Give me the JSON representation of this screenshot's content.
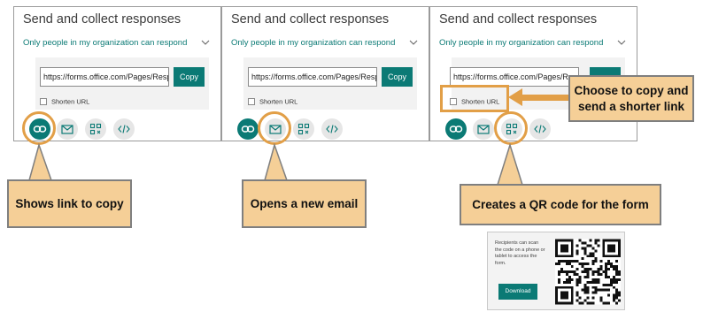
{
  "panels": [
    {
      "title": "Send and collect responses",
      "dropdown": "Only people in my organization can respond",
      "url": "https://forms.office.com/Pages/ResponsePage.aspx",
      "copy_label": "Copy",
      "shorten_label": "Shorten URL"
    },
    {
      "title": "Send and collect responses",
      "dropdown": "Only people in my organization can respond",
      "url": "https://forms.office.com/Pages/ResponsePage.aspx",
      "copy_label": "Copy",
      "shorten_label": "Shorten URL"
    },
    {
      "title": "Send and collect responses",
      "dropdown": "Only people in my organization can respond",
      "url": "https://forms.office.com/Pages/ResponsePage.aspx",
      "copy_label": "",
      "shorten_label": "Shorten URL"
    }
  ],
  "icons": [
    "link-icon",
    "mail-icon",
    "qr-code-icon",
    "embed-code-icon"
  ],
  "callouts": {
    "link": "Shows link to copy",
    "email": "Opens a new email",
    "qr": "Creates a QR code for the form",
    "shorten_line1": "Choose to copy and",
    "shorten_line2": "send a shorter link"
  },
  "qr_card": {
    "description": "Recipients can scan the code on a phone or tablet to access the form.",
    "download_label": "Download"
  },
  "colors": {
    "accent": "#0b7a75",
    "callout_fill": "#f5cf97",
    "highlight": "#e29f47"
  }
}
